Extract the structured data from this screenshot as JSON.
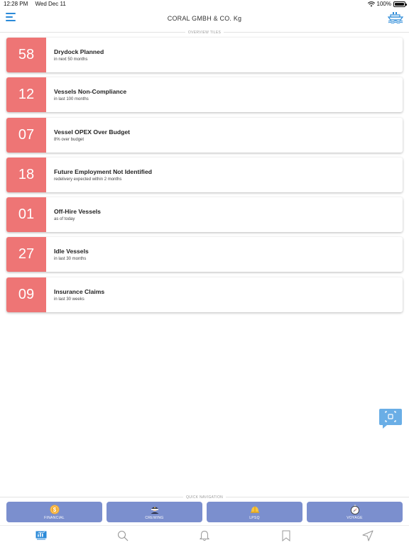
{
  "status": {
    "time": "12:28 PM",
    "date": "Wed Dec 11",
    "battery": "100%",
    "battery_level": 1.0
  },
  "header": {
    "title": "CORAL GMBH & CO. Kg"
  },
  "overview": {
    "label": "OVERVIEW TILES"
  },
  "tiles": [
    {
      "value": "58",
      "title": "Drydock Planned",
      "subtitle": "in next 50 months"
    },
    {
      "value": "12",
      "title": "Vessels Non-Compliance",
      "subtitle": "in last 100 months"
    },
    {
      "value": "07",
      "title": "Vessel OPEX Over Budget",
      "subtitle": "8% over budget"
    },
    {
      "value": "18",
      "title": "Future Employment Not Identified",
      "subtitle": "redelivery expected within 2 months"
    },
    {
      "value": "01",
      "title": "Off-Hire Vessels",
      "subtitle": "as of today"
    },
    {
      "value": "27",
      "title": "Idle Vessels",
      "subtitle": "in last 30 months"
    },
    {
      "value": "09",
      "title": "Insurance Claims",
      "subtitle": "in last 30 weeks"
    }
  ],
  "quick_nav": {
    "label": "QUICK NAVIGATION",
    "items": [
      {
        "label": "FINANCIAL",
        "icon": "dollar-coin-icon"
      },
      {
        "label": "CREWING",
        "icon": "crew-captain-icon"
      },
      {
        "label": "LPSQ",
        "icon": "hard-hat-icon"
      },
      {
        "label": "VOYAGE",
        "icon": "compass-icon"
      }
    ]
  },
  "tab_bar": {
    "items": [
      {
        "icon": "dashboard-icon",
        "active": true
      },
      {
        "icon": "search-icon"
      },
      {
        "icon": "bell-icon"
      },
      {
        "icon": "bookmark-icon"
      },
      {
        "icon": "navigation-arrow-icon"
      }
    ]
  },
  "colors": {
    "tile_accent": "#ee7575",
    "quick_nav_bg": "#7b8fce",
    "brand_blue": "#2b8ad8",
    "chat_bubble": "#6aaee6"
  }
}
